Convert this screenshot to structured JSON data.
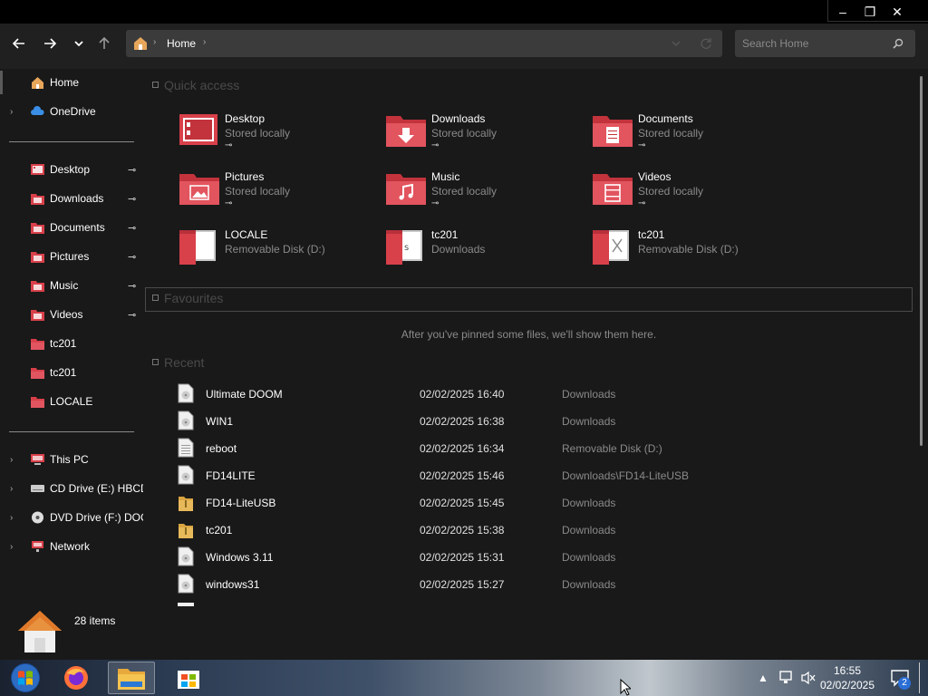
{
  "window": {
    "controls": {
      "minimize": "–",
      "maximize": "❐",
      "close": "✕"
    }
  },
  "nav": {
    "breadcrumb": "Home",
    "search_placeholder": "Search Home"
  },
  "sidebar": {
    "top": [
      {
        "label": "Home",
        "icon": "home-icon"
      },
      {
        "label": "OneDrive",
        "icon": "cloud-icon"
      }
    ],
    "pinned": [
      {
        "label": "Desktop",
        "icon": "desktop-folder-icon",
        "pinned": true
      },
      {
        "label": "Downloads",
        "icon": "downloads-folder-icon",
        "pinned": true
      },
      {
        "label": "Documents",
        "icon": "documents-folder-icon",
        "pinned": true
      },
      {
        "label": "Pictures",
        "icon": "pictures-folder-icon",
        "pinned": true
      },
      {
        "label": "Music",
        "icon": "music-folder-icon",
        "pinned": true
      },
      {
        "label": "Videos",
        "icon": "videos-folder-icon",
        "pinned": true
      },
      {
        "label": "tc201",
        "icon": "folder-icon",
        "pinned": false
      },
      {
        "label": "tc201",
        "icon": "folder-icon",
        "pinned": false
      },
      {
        "label": "LOCALE",
        "icon": "folder-icon",
        "pinned": false
      }
    ],
    "devices": [
      {
        "label": "This PC",
        "icon": "computer-icon"
      },
      {
        "label": "CD Drive (E:) HBCD",
        "icon": "cd-drive-icon"
      },
      {
        "label": "DVD Drive (F:) DOO",
        "icon": "dvd-drive-icon"
      },
      {
        "label": "Network",
        "icon": "network-icon"
      }
    ]
  },
  "quick_access": {
    "title": "Quick access",
    "items": [
      {
        "name": "Desktop",
        "sub": "Stored locally",
        "icon": "desktop-folder-icon",
        "pinned": true
      },
      {
        "name": "Downloads",
        "sub": "Stored locally",
        "icon": "downloads-folder-icon",
        "pinned": true
      },
      {
        "name": "Documents",
        "sub": "Stored locally",
        "icon": "documents-folder-icon",
        "pinned": true
      },
      {
        "name": "Pictures",
        "sub": "Stored locally",
        "icon": "pictures-folder-icon",
        "pinned": true
      },
      {
        "name": "Music",
        "sub": "Stored locally",
        "icon": "music-folder-icon",
        "pinned": true
      },
      {
        "name": "Videos",
        "sub": "Stored locally",
        "icon": "videos-folder-icon",
        "pinned": true
      },
      {
        "name": "LOCALE",
        "sub": "Removable Disk (D:)",
        "icon": "open-folder-icon",
        "pinned": false
      },
      {
        "name": "tc201",
        "sub": "Downloads",
        "icon": "open-folder-icon",
        "pinned": false
      },
      {
        "name": "tc201",
        "sub": "Removable Disk (D:)",
        "icon": "open-folder-icon",
        "pinned": false
      }
    ]
  },
  "favourites": {
    "title": "Favourites",
    "empty_message": "After you've pinned some files, we'll show them here."
  },
  "recent": {
    "title": "Recent",
    "rows": [
      {
        "name": "Ultimate DOOM",
        "date": "02/02/2025 16:40",
        "location": "Downloads",
        "icon": "disc-image-icon"
      },
      {
        "name": "WIN1",
        "date": "02/02/2025 16:38",
        "location": "Downloads",
        "icon": "disc-image-icon"
      },
      {
        "name": "reboot",
        "date": "02/02/2025 16:34",
        "location": "Removable Disk (D:)",
        "icon": "text-file-icon"
      },
      {
        "name": "FD14LITE",
        "date": "02/02/2025 15:46",
        "location": "Downloads\\FD14-LiteUSB",
        "icon": "disc-image-icon"
      },
      {
        "name": "FD14-LiteUSB",
        "date": "02/02/2025 15:45",
        "location": "Downloads",
        "icon": "archive-icon"
      },
      {
        "name": "tc201",
        "date": "02/02/2025 15:38",
        "location": "Downloads",
        "icon": "archive-icon"
      },
      {
        "name": "Windows 3.11",
        "date": "02/02/2025 15:31",
        "location": "Downloads",
        "icon": "disc-image-icon"
      },
      {
        "name": "windows31",
        "date": "02/02/2025 15:27",
        "location": "Downloads",
        "icon": "disc-image-icon"
      }
    ]
  },
  "status": {
    "item_count": "28 items"
  },
  "taskbar": {
    "apps": [
      {
        "name": "start-button",
        "icon": "windows-orb-icon"
      },
      {
        "name": "firefox",
        "icon": "firefox-icon"
      },
      {
        "name": "file-explorer",
        "icon": "folder-icon",
        "active": true
      },
      {
        "name": "store",
        "icon": "store-icon"
      }
    ],
    "time": "16:55",
    "date": "02/02/2025",
    "notification_count": "2"
  },
  "colors": {
    "accent_red": "#d9363e",
    "folder_red": "#d8404a",
    "panel_bg": "#191919",
    "nav_bg": "#202020"
  }
}
